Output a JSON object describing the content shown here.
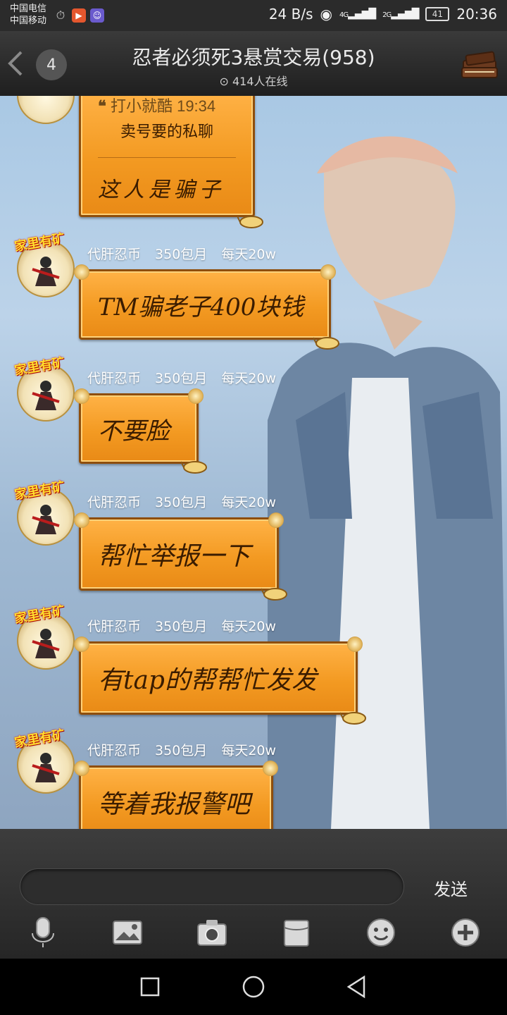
{
  "status_bar": {
    "carrier1": "中国电信",
    "carrier2": "中国移动",
    "speed": "24 B/s",
    "net_4g": "4G",
    "net_2g": "2G",
    "battery": "41",
    "time": "20:36"
  },
  "header": {
    "unread_count": "4",
    "title": "忍者必须死3悬赏交易(958)",
    "online": "414人在线"
  },
  "quote_message": {
    "quote_author_time": "打小就酷 19:34",
    "quote_text": "卖号要的私聊",
    "reply_text": "这人是骗子"
  },
  "avatar_badge": "家里有矿",
  "sender_name": "代肝忍币 350包月 每天20w",
  "messages": [
    {
      "sender": "代肝忍币 350包月 每天20w",
      "text": "TM骗老子400块钱"
    },
    {
      "sender": "代肝忍币 350包月 每天20w",
      "text": "不要脸"
    },
    {
      "sender": "代肝忍币 350包月 每天20w",
      "text": "帮忙举报一下"
    },
    {
      "sender": "代肝忍币 350包月 每天20w",
      "text": "有tap的帮帮忙发发"
    },
    {
      "sender": "代肝忍币 350包月 每天20w",
      "text": "等着我报警吧"
    }
  ],
  "input": {
    "value": "",
    "send_label": "发送"
  },
  "toolbar_icons": [
    "microphone-icon",
    "image-icon",
    "camera-icon",
    "file-icon",
    "emoji-icon",
    "plus-icon"
  ],
  "colors": {
    "bubble": "#f39a22",
    "bubble_border": "#8f4e0b",
    "header_bg": "#2b2b2b"
  }
}
